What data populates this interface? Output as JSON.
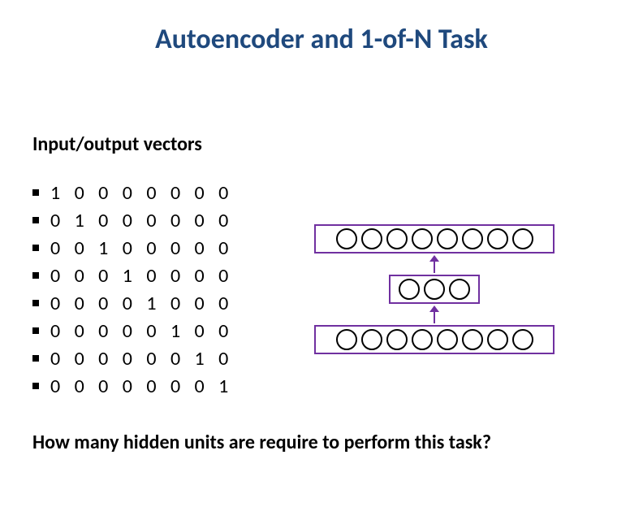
{
  "title": "Autoencoder and 1-of-N Task",
  "subtitle": "Input/output vectors",
  "vectors": [
    "1 0 0 0 0 0 0 0",
    "0 1 0 0 0 0 0 0",
    "0 0 1 0 0 0 0 0",
    "0 0 0 1 0 0 0 0",
    "0 0 0 0 1 0 0 0",
    "0 0 0 0 0 1 0 0",
    "0 0 0 0 0 0 1 0",
    "0 0 0 0 0 0 0 1"
  ],
  "question": "How many hidden units are require to perform this task?",
  "chart_data": {
    "type": "diagram",
    "description": "Three-layer neural network schematic (autoencoder)",
    "layers": [
      {
        "name": "output",
        "units": 8
      },
      {
        "name": "hidden",
        "units": 3
      },
      {
        "name": "input",
        "units": 8
      }
    ],
    "arrows": [
      {
        "from": "input",
        "to": "hidden",
        "direction": "up"
      },
      {
        "from": "hidden",
        "to": "output",
        "direction": "up"
      }
    ],
    "colors": {
      "layer_border": "#7030a0",
      "node_border": "#000000",
      "arrow": "#7030a0"
    }
  }
}
